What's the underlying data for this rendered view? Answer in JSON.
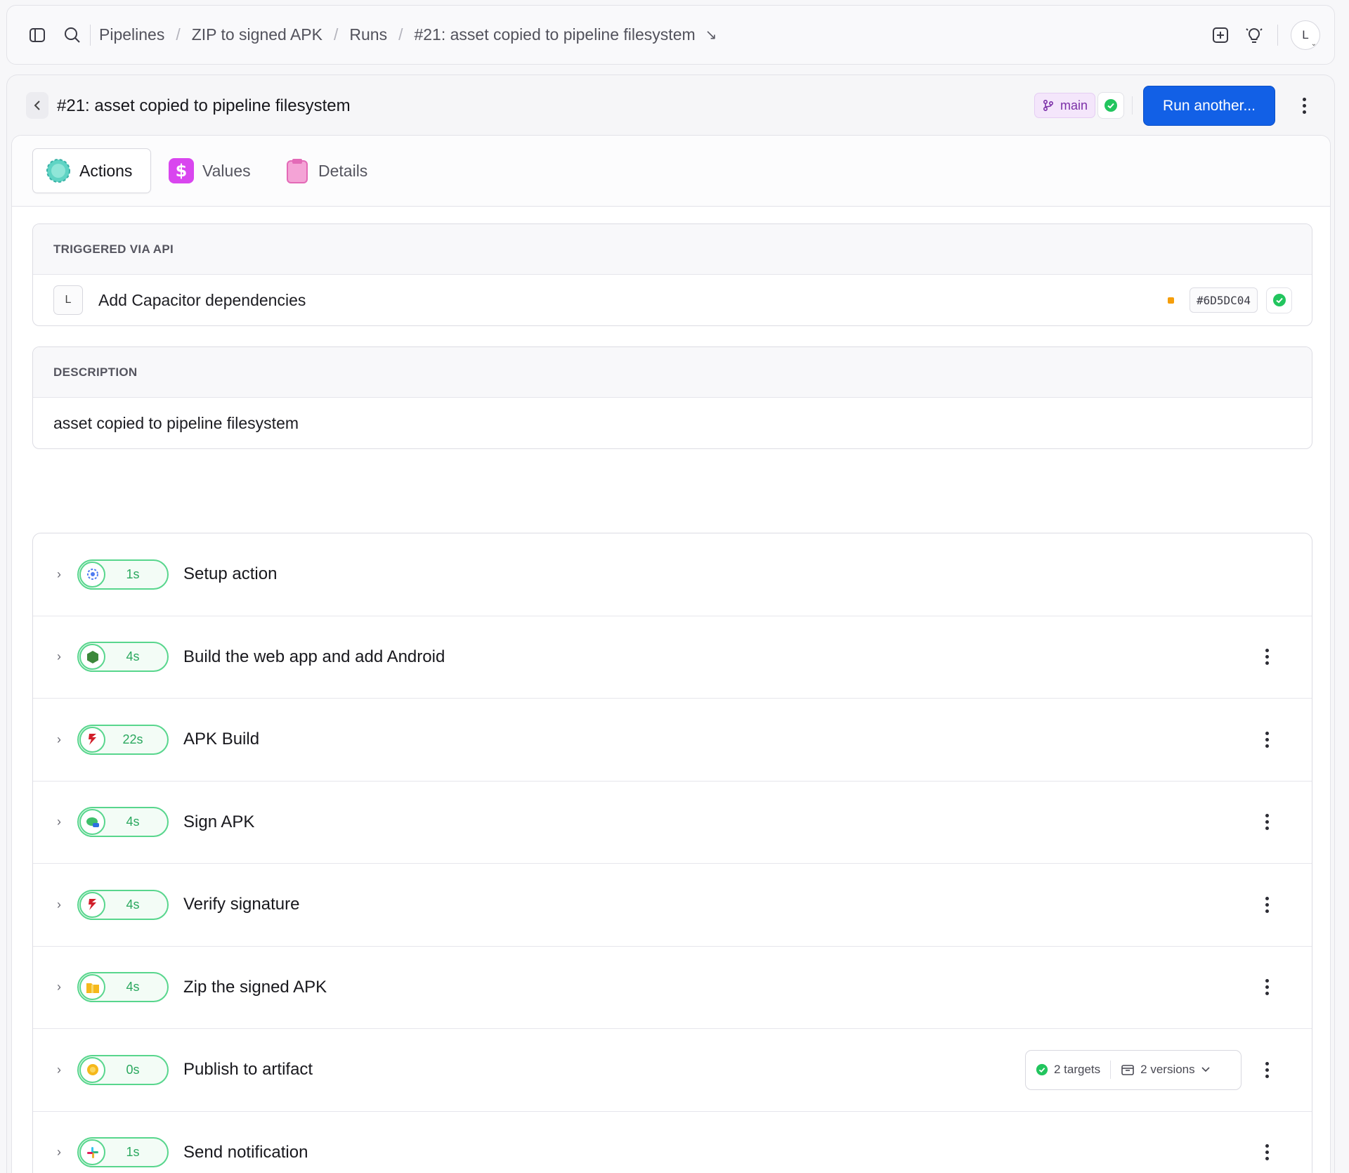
{
  "topbar": {
    "breadcrumbs": [
      "Pipelines",
      "ZIP to signed APK",
      "Runs",
      "#21: asset copied to pipeline filesystem"
    ],
    "user_initial": "L"
  },
  "run": {
    "title": "#21: asset copied to pipeline filesystem",
    "branch": "main",
    "run_another_label": "Run another..."
  },
  "tabs": [
    {
      "label": "Actions",
      "active": true
    },
    {
      "label": "Values",
      "active": false
    },
    {
      "label": "Details",
      "active": false
    }
  ],
  "trigger": {
    "heading": "TRIGGERED VIA API",
    "author_initial": "L",
    "commit_message": "Add Capacitor dependencies",
    "commit_sha": "#6D5DC04"
  },
  "description": {
    "heading": "DESCRIPTION",
    "text": "asset copied to pipeline filesystem"
  },
  "steps": [
    {
      "name": "Setup action",
      "duration": "1s",
      "icon": "gear-icon"
    },
    {
      "name": "Build the web app and add Android",
      "duration": "4s",
      "icon": "nodejs-icon"
    },
    {
      "name": "APK Build",
      "duration": "22s",
      "icon": "gradle-icon"
    },
    {
      "name": "Sign APK",
      "duration": "4s",
      "icon": "signature-icon"
    },
    {
      "name": "Verify signature",
      "duration": "4s",
      "icon": "gradle-icon"
    },
    {
      "name": "Zip the signed APK",
      "duration": "4s",
      "icon": "folder-zip-icon"
    },
    {
      "name": "Publish to artifact",
      "duration": "0s",
      "icon": "artifact-icon"
    },
    {
      "name": "Send notification",
      "duration": "1s",
      "icon": "slack-icon"
    }
  ],
  "artifact": {
    "targets_label": "2 targets",
    "versions_label": "2 versions"
  },
  "colors": {
    "accent": "#1260e6",
    "success": "#22c55e",
    "branch": "#7b2fa8"
  }
}
